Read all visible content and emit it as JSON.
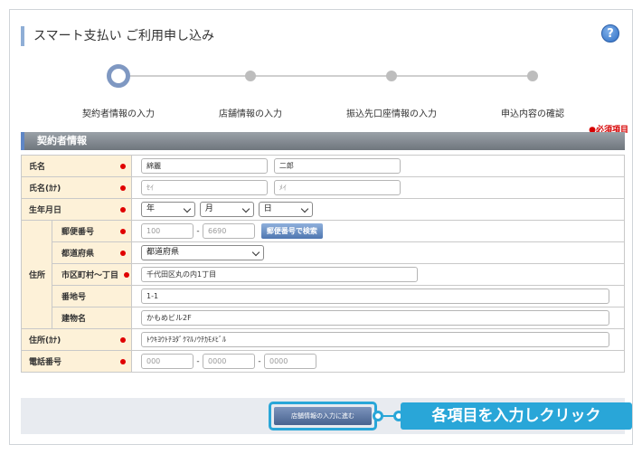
{
  "page": {
    "title": "スマート支払い ご利用申し込み",
    "help_icon": "?"
  },
  "steps": [
    {
      "label": "契約者情報の入力",
      "active": true
    },
    {
      "label": "店舗情報の入力",
      "active": false
    },
    {
      "label": "振込先口座情報の入力",
      "active": false
    },
    {
      "label": "申込内容の確認",
      "active": false
    }
  ],
  "required_note": "●必須項目",
  "section": {
    "title": "契約者情報"
  },
  "form": {
    "name": {
      "label": "氏名",
      "last": "綿麗",
      "first": "二郎"
    },
    "kana": {
      "label": "氏名(ｶﾅ)",
      "last_placeholder": "ｾｲ",
      "first_placeholder": "ﾒｲ"
    },
    "birthdate": {
      "label": "生年月日",
      "year": "年",
      "month": "月",
      "day": "日"
    },
    "address": {
      "label": "住所",
      "postal": {
        "label": "郵便番号",
        "part1": "100",
        "part2": "6690",
        "search_button": "郵便番号で検索"
      },
      "prefecture": {
        "label": "都道府県",
        "value": "都道府県"
      },
      "city": {
        "label": "市区町村～丁目",
        "value": "千代田区丸の内1丁目"
      },
      "number": {
        "label": "番地号",
        "value": "1-1"
      },
      "building": {
        "label": "建物名",
        "value": "かもめビル2F"
      }
    },
    "address_kana": {
      "label": "住所(ｶﾅ)",
      "value": "ﾄｳｷﾖｳﾄﾁﾖﾀﾞｸﾏﾙﾉｳﾁｶﾓﾒﾋﾞﾙ"
    },
    "phone": {
      "label": "電話番号",
      "part1": "000",
      "part2": "0000",
      "part3": "0000"
    },
    "dash": "-"
  },
  "footer": {
    "next_button": "店舗情報の入力に進む",
    "callout": "各項目を入力しクリック"
  },
  "colors": {
    "accent": "#29a6d8",
    "required": "#e00000",
    "label_bg": "#fdf1d8"
  }
}
